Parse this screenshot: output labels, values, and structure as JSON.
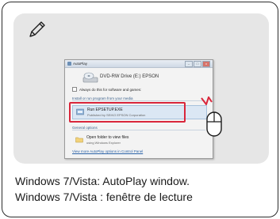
{
  "dialog": {
    "title": "AutoPlay",
    "window_buttons": [
      "–",
      "□",
      "x"
    ],
    "drive_label": "DVD-RW Drive (E:) EPSON",
    "checkbox_label": "Always do this for software and games:",
    "section_install": "Install or run program from your media",
    "option_run_title": "Run EPSETUP.EXE",
    "option_run_sub": "Published by SEIKO EPSON Corporation",
    "section_general": "General options",
    "option_open_title": "Open folder to view files",
    "option_open_sub": "using Windows Explorer",
    "footer_link": "View more AutoPlay options in Control Panel"
  },
  "captions": {
    "line1": "Windows 7/Vista: AutoPlay window.",
    "line2": "Windows 7/Vista : fenêtre de lecture"
  },
  "colors": {
    "highlight": "#d9263b",
    "panel_bg": "#e6e6e6"
  },
  "icons": {
    "note": "pencil-icon",
    "mouse": "mouse-click-icon"
  }
}
